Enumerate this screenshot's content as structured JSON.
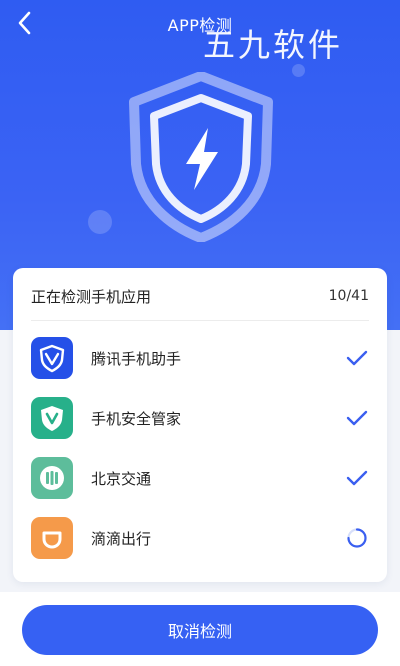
{
  "header": {
    "title": "APP检测",
    "back_icon": "chevron-left-icon",
    "watermark": "五九软件",
    "emblem_icon": "shield-lightning-icon"
  },
  "scan": {
    "heading": "正在检测手机应用",
    "progress": "10/41",
    "apps": [
      {
        "name": "腾讯手机助手",
        "icon": "tencent-assistant-icon",
        "status": "done",
        "status_icon": "checkmark-icon"
      },
      {
        "name": "手机安全管家",
        "icon": "security-manager-icon",
        "status": "done",
        "status_icon": "checkmark-icon"
      },
      {
        "name": "北京交通",
        "icon": "beijing-transit-icon",
        "status": "done",
        "status_icon": "checkmark-icon"
      },
      {
        "name": "滴滴出行",
        "icon": "didi-icon",
        "status": "scanning",
        "status_icon": "loading-spinner-icon"
      }
    ]
  },
  "actions": {
    "cancel_label": "取消检测"
  },
  "colors": {
    "primary": "#3661f3",
    "check": "#3a5ff0",
    "didi": "#f59a4a",
    "security": "#27b08a",
    "transit": "#5dbd9b",
    "tencent": "#2550e8"
  }
}
